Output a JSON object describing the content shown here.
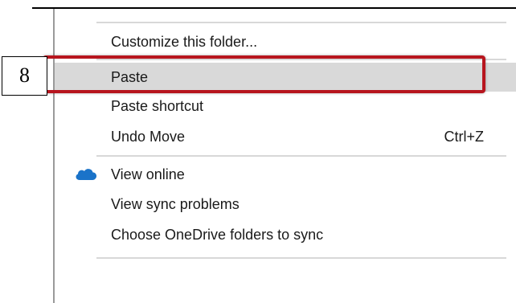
{
  "menu": {
    "items": [
      {
        "label": "Customize this folder..."
      },
      {
        "label": "Paste",
        "highlighted": true
      },
      {
        "label": "Paste shortcut"
      },
      {
        "label": "Undo Move",
        "shortcut": "Ctrl+Z"
      },
      {
        "label": "View online",
        "icon": "onedrive-cloud-icon"
      },
      {
        "label": "View sync problems"
      },
      {
        "label": "Choose OneDrive folders to sync"
      }
    ]
  },
  "annotation": {
    "step_number": "8",
    "highlight_color": "#b7151e"
  },
  "colors": {
    "menu_highlight": "#d9d9d9",
    "onedrive_blue": "#1a73c9",
    "separator": "#d8d8d8"
  }
}
